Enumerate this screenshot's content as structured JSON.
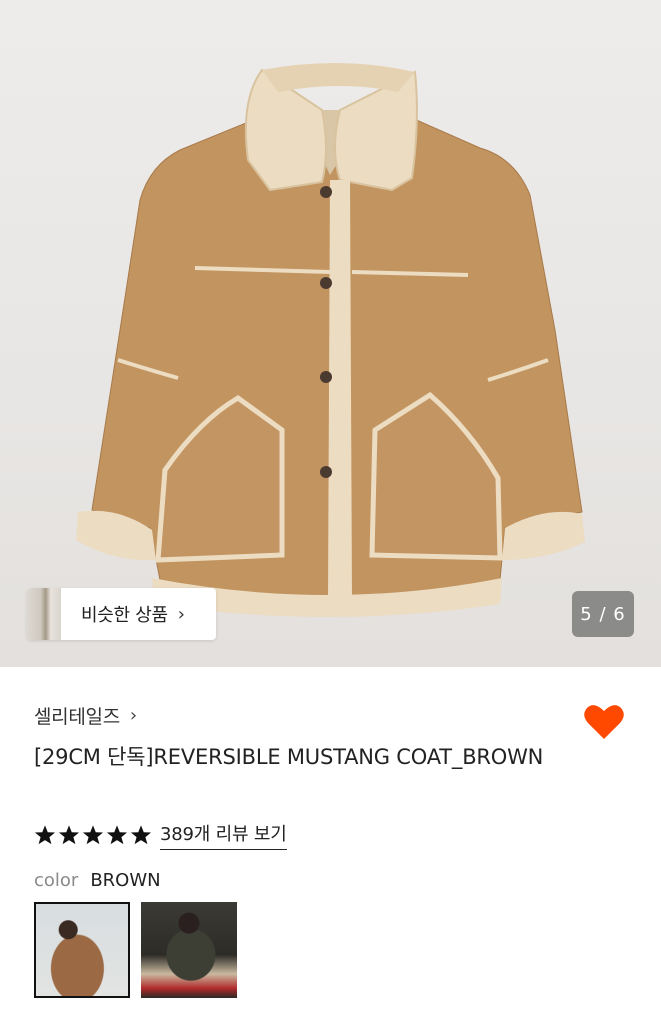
{
  "gallery": {
    "similar_label": "비슷한 상품",
    "similar_chevron": "›",
    "page_indicator": "5 / 6",
    "current_index": 5,
    "total": 6,
    "similar_icon": "chevron-right-icon"
  },
  "product": {
    "brand": "셀리테일즈",
    "brand_chevron": "›",
    "title": "[29CM 단독]REVERSIBLE MUSTANG COAT_BROWN",
    "rating_stars": 5,
    "review_link": "389개 리뷰 보기",
    "color_key": "color",
    "color_value": "BROWN",
    "liked": true,
    "like_icon": "heart-icon",
    "star_icon": "star-icon"
  },
  "colors": {
    "accent": "#ff4800",
    "star": "#111111",
    "coat": "#c29460",
    "shearling": "#ecdcc2"
  },
  "swatches": [
    {
      "name": "swatch-model-brown",
      "selected": true
    },
    {
      "name": "swatch-model-outdoor",
      "selected": false
    }
  ]
}
